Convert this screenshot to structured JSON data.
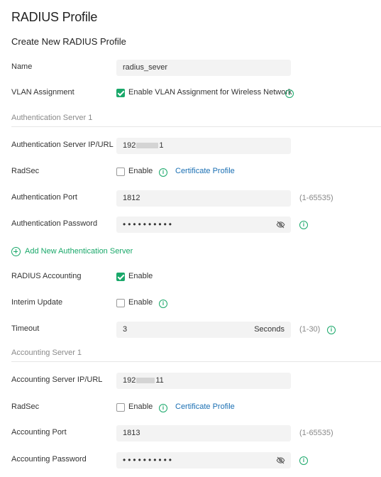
{
  "page": {
    "title": "RADIUS Profile",
    "section_title": "Create New RADIUS Profile"
  },
  "name_field": {
    "label": "Name",
    "value": "radius_sever"
  },
  "vlan": {
    "label": "VLAN Assignment",
    "checkbox_label": "Enable VLAN Assignment for Wireless Network",
    "checked": true
  },
  "auth_server": {
    "header": "Authentication Server 1",
    "ip": {
      "label": "Authentication Server IP/URL",
      "value_prefix": "192",
      "value_suffix": "1"
    },
    "radsec": {
      "label": "RadSec",
      "checkbox_label": "Enable",
      "checked": false,
      "link": "Certificate Profile"
    },
    "port": {
      "label": "Authentication Port",
      "value": "1812",
      "range": "(1-65535)"
    },
    "password": {
      "label": "Authentication Password",
      "value": "••••••••••"
    }
  },
  "add_auth_server": {
    "label": "Add New Authentication Server"
  },
  "accounting": {
    "label": "RADIUS Accounting",
    "checkbox_label": "Enable",
    "checked": true
  },
  "interim": {
    "label": "Interim Update",
    "checkbox_label": "Enable",
    "checked": false
  },
  "timeout": {
    "label": "Timeout",
    "value": "3",
    "unit": "Seconds",
    "range": "(1-30)"
  },
  "acct_server": {
    "header": "Accounting Server 1",
    "ip": {
      "label": "Accounting Server IP/URL",
      "value_prefix": "192",
      "value_suffix": "11"
    },
    "radsec": {
      "label": "RadSec",
      "checkbox_label": "Enable",
      "checked": false,
      "link": "Certificate Profile"
    },
    "port": {
      "label": "Accounting Port",
      "value": "1813",
      "range": "(1-65535)"
    },
    "password": {
      "label": "Accounting Password",
      "value": "••••••••••"
    }
  },
  "colors": {
    "accent": "#1aa86a",
    "link": "#1a6fb3",
    "input_bg": "#f3f3f3"
  },
  "icons": {
    "info": "info-icon",
    "eye_off": "eye-off-icon",
    "add": "plus-circle-icon"
  }
}
